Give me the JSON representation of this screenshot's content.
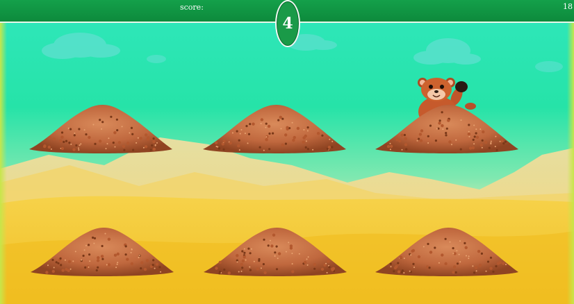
{
  "hud": {
    "score_label": "score:",
    "score_value": "18",
    "timer": "4"
  },
  "colors": {
    "bar": "#0d8a3c",
    "sky": "#2ee6b8",
    "sand": "#f2c92a",
    "dirt": "#c0683e"
  },
  "mounds": [
    {
      "row": 1,
      "col": 1,
      "has_mole": false
    },
    {
      "row": 1,
      "col": 2,
      "has_mole": false
    },
    {
      "row": 1,
      "col": 3,
      "has_mole": true
    },
    {
      "row": 2,
      "col": 1,
      "has_mole": false
    },
    {
      "row": 2,
      "col": 2,
      "has_mole": false
    },
    {
      "row": 2,
      "col": 3,
      "has_mole": false
    }
  ]
}
